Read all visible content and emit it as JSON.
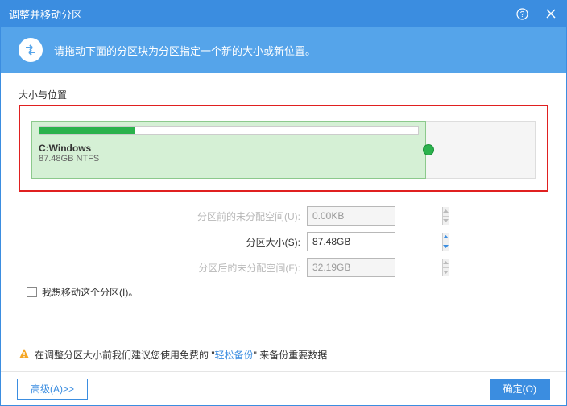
{
  "titlebar": {
    "title": "调整并移动分区"
  },
  "banner": {
    "text": "请拖动下面的分区块为分区指定一个新的大小或新位置。"
  },
  "section": {
    "label": "大小与位置"
  },
  "partition": {
    "name": "C:Windows",
    "info": "87.48GB NTFS"
  },
  "fields": {
    "before": {
      "label": "分区前的未分配空间(U):",
      "value": "0.00KB"
    },
    "size": {
      "label": "分区大小(S):",
      "value": "87.48GB"
    },
    "after": {
      "label": "分区后的未分配空间(F):",
      "value": "32.19GB"
    }
  },
  "checkbox": {
    "label": "我想移动这个分区(I)。"
  },
  "warning": {
    "prefix": "在调整分区大小前我们建议您使用免费的 \"",
    "link": "轻松备份",
    "suffix": "\" 来备份重要数据"
  },
  "footer": {
    "advanced": "高级(A)>>",
    "ok": "确定(O)"
  }
}
